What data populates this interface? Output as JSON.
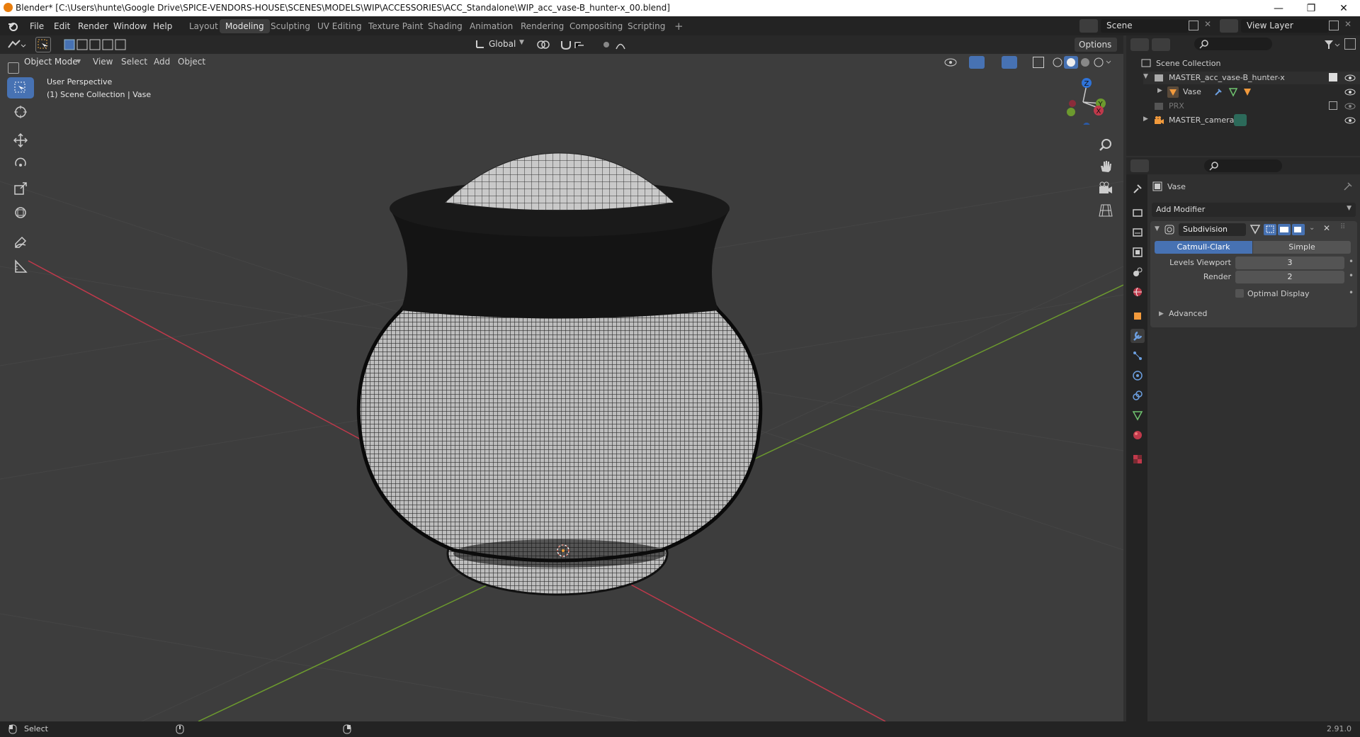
{
  "window": {
    "title": "Blender* [C:\\Users\\hunte\\Google Drive\\SPICE-VENDORS-HOUSE\\SCENES\\MODELS\\WIP\\ACCESSORIES\\ACC_Standalone\\WIP_acc_vase-B_hunter-x_00.blend]",
    "minimize": "—",
    "maximize": "❐",
    "close": "✕"
  },
  "menu": {
    "file": "File",
    "edit": "Edit",
    "render": "Render",
    "window": "Window",
    "help": "Help"
  },
  "workspaces": [
    "Layout",
    "Modeling",
    "Sculpting",
    "UV Editing",
    "Texture Paint",
    "Shading",
    "Animation",
    "Rendering",
    "Compositing",
    "Scripting"
  ],
  "active_workspace": "Modeling",
  "scene": {
    "name": "Scene",
    "view_layer": "View Layer"
  },
  "toolbar": {
    "orientation": "Global",
    "options": "Options"
  },
  "viewport_header": {
    "mode": "Object Mode",
    "view": "View",
    "select": "Select",
    "add": "Add",
    "object": "Object"
  },
  "viewport": {
    "perspective": "User Perspective",
    "collection_info": "(1) Scene Collection | Vase"
  },
  "outliner": {
    "root": "Scene Collection",
    "items": [
      {
        "name": "MASTER_acc_vase-B_hunter-x"
      },
      {
        "name": "Vase"
      },
      {
        "name": "PRX"
      },
      {
        "name": "MASTER_camera"
      }
    ]
  },
  "properties": {
    "object_name": "Vase",
    "add_modifier": "Add Modifier",
    "modifier_name": "Subdivision",
    "tab_catmull": "Catmull-Clark",
    "tab_simple": "Simple",
    "levels_viewport_label": "Levels Viewport",
    "levels_viewport": "3",
    "render_label": "Render",
    "render": "2",
    "optimal_display": "Optimal Display",
    "advanced": "Advanced"
  },
  "status": {
    "select": "Select",
    "version": "2.91.0"
  },
  "colors": {
    "accent": "#4772b3",
    "x_axis": "#c0394b",
    "y_axis": "#6c9a2e",
    "z_axis": "#2f73d8"
  }
}
